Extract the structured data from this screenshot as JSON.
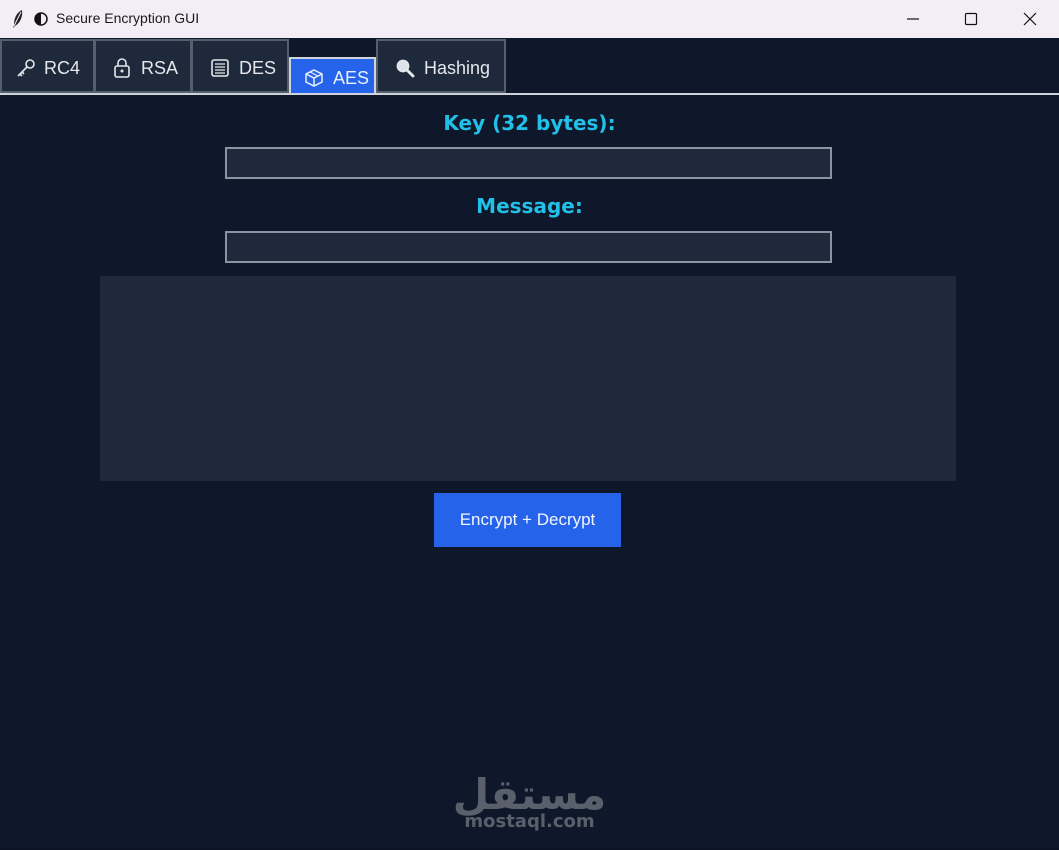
{
  "window": {
    "title": "Secure Encryption GUI",
    "buttons": [
      "minimize",
      "maximize",
      "close"
    ]
  },
  "tabs": [
    {
      "label": "RC4",
      "icon": "key-icon",
      "active": false
    },
    {
      "label": "RSA",
      "icon": "lock-icon",
      "active": false
    },
    {
      "label": "DES",
      "icon": "document-icon",
      "active": false
    },
    {
      "label": "AES",
      "icon": "cube-icon",
      "active": true
    },
    {
      "label": "Hashing",
      "icon": "magnifier-icon",
      "active": false
    }
  ],
  "form": {
    "key_label": "Key (32 bytes):",
    "key_value": "",
    "message_label": "Message:",
    "message_value": "",
    "output_value": "",
    "action_label": "Encrypt + Decrypt"
  },
  "watermark": {
    "arabic": "مستقل",
    "latin": "mostaql.com"
  },
  "colors": {
    "background": "#0f172a",
    "panel": "#1e293b",
    "accent": "#2563eb",
    "label": "#22c0e8"
  }
}
